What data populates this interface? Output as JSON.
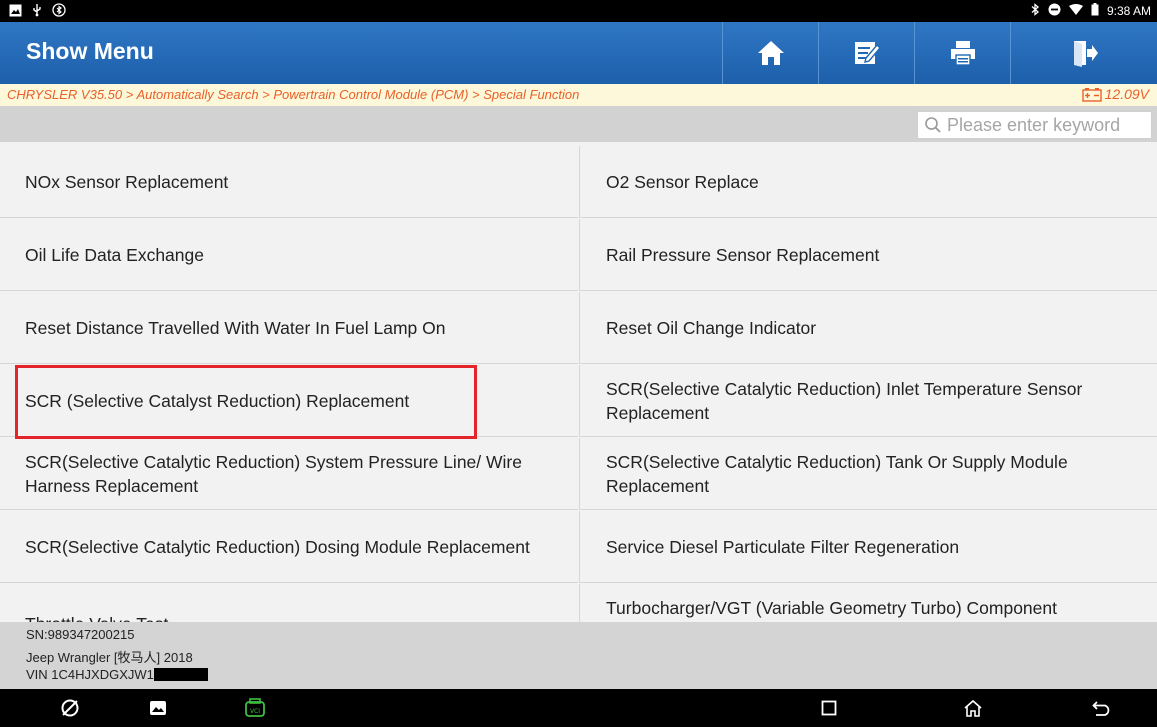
{
  "status_bar": {
    "time": "9:38 AM"
  },
  "header": {
    "title": "Show Menu",
    "buttons": [
      {
        "icon": "home-icon"
      },
      {
        "icon": "edit-icon"
      },
      {
        "icon": "print-icon"
      },
      {
        "icon": "exit-icon"
      }
    ]
  },
  "breadcrumb": {
    "path": "CHRYSLER V35.50 > Automatically Search > Powertrain Control Module (PCM) > Special Function",
    "voltage": "12.09V"
  },
  "search": {
    "placeholder": "Please enter keyword"
  },
  "menu": {
    "items": [
      "NOx Sensor Replacement",
      "O2 Sensor Replace",
      "Oil Life Data Exchange",
      "Rail Pressure Sensor Replacement",
      "Reset Distance Travelled With Water In Fuel Lamp On",
      "Reset Oil Change Indicator",
      "SCR (Selective Catalyst Reduction) Replacement",
      "SCR(Selective Catalytic Reduction) Inlet Temperature Sensor Replacement",
      "SCR(Selective Catalytic Reduction) System Pressure Line/ Wire Harness Replacement",
      "SCR(Selective Catalytic Reduction) Tank Or Supply Module Replacement",
      "SCR(Selective Catalytic Reduction) Dosing Module Replacement",
      "Service Diesel Particulate Filter Regeneration",
      "Throttle Valve Test",
      "Turbocharger/VGT (Variable Geometry Turbo) Component"
    ],
    "highlighted": "SCR (Selective Catalyst Reduction) Replacement"
  },
  "footer": {
    "sn": "SN:989347200215",
    "vehicle": "Jeep Wrangler [牧马人] 2018",
    "vin": "VIN 1C4HJXDGXJW1"
  },
  "colors": {
    "header_blue": "#2068b4",
    "breadcrumb_text": "#e9602a",
    "highlight_red": "#e3242b"
  }
}
